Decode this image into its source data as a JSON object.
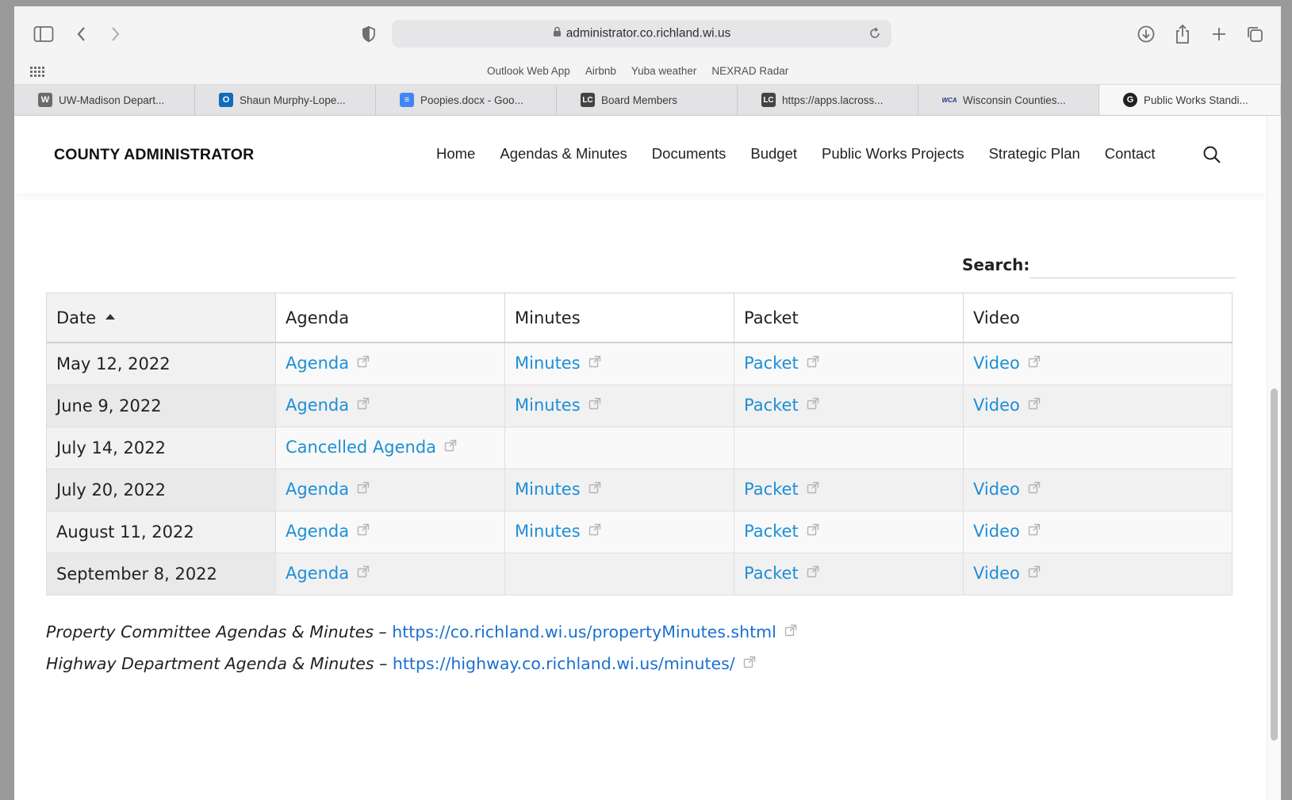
{
  "browser": {
    "url": "administrator.co.richland.wi.us",
    "bookmarks": [
      "Outlook Web App",
      "Airbnb",
      "Yuba weather",
      "NEXRAD Radar"
    ],
    "tabs": [
      {
        "label": "UW-Madison Depart...",
        "icon": "W",
        "color": "#6b6b6b"
      },
      {
        "label": "Shaun Murphy-Lope...",
        "icon": "O",
        "color": "#0f6cbd"
      },
      {
        "label": "Poopies.docx - Goo...",
        "icon": "≡",
        "color": "#4285f4"
      },
      {
        "label": "Board Members",
        "icon": "LC",
        "color": "#444444"
      },
      {
        "label": "https://apps.lacross...",
        "icon": "LC",
        "color": "#444444"
      },
      {
        "label": "Wisconsin Counties...",
        "icon": "WCA",
        "color": "#1a3a7a"
      },
      {
        "label": "Public Works Standi...",
        "icon": "G",
        "color": "#222222"
      }
    ]
  },
  "site": {
    "title": "COUNTY ADMINISTRATOR",
    "nav": [
      "Home",
      "Agendas & Minutes",
      "Documents",
      "Budget",
      "Public Works Projects",
      "Strategic Plan",
      "Contact"
    ]
  },
  "search": {
    "label": "Search:",
    "value": ""
  },
  "table": {
    "headers": [
      "Date",
      "Agenda",
      "Minutes",
      "Packet",
      "Video"
    ],
    "rows": [
      {
        "date": "May 12, 2022",
        "agenda": "Agenda",
        "minutes": "Minutes",
        "packet": "Packet",
        "video": "Video"
      },
      {
        "date": "June 9, 2022",
        "agenda": "Agenda",
        "minutes": "Minutes",
        "packet": "Packet",
        "video": "Video"
      },
      {
        "date": "July 14, 2022",
        "agenda": "Cancelled Agenda",
        "minutes": "",
        "packet": "",
        "video": ""
      },
      {
        "date": "July 20, 2022",
        "agenda": "Agenda",
        "minutes": "Minutes",
        "packet": "Packet",
        "video": "Video"
      },
      {
        "date": "August 11, 2022",
        "agenda": "Agenda",
        "minutes": "Minutes",
        "packet": "Packet",
        "video": "Video"
      },
      {
        "date": "September 8, 2022",
        "agenda": "Agenda",
        "minutes": "",
        "packet": "Packet",
        "video": "Video"
      }
    ]
  },
  "footer": {
    "property": {
      "label": "Property Committee Agendas & Minutes – ",
      "link": "https://co.richland.wi.us/propertyMinutes.shtml"
    },
    "highway": {
      "label": "Highway Department Agenda & Minutes – ",
      "link": "https://highway.co.richland.wi.us/minutes/"
    }
  },
  "colors": {
    "link": "#1e8fd6",
    "footer_link": "#1a6fd0"
  }
}
